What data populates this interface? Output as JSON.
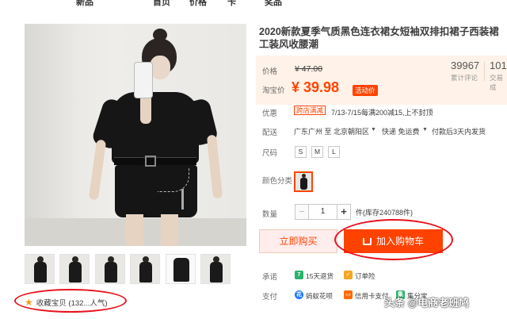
{
  "header": {
    "nav_fragments": [
      "新品",
      "首页",
      "价格",
      "卡",
      "奖品"
    ]
  },
  "product": {
    "title": "2020新款夏季气质黑色连衣裙女短袖双排扣裙子西装裙工装风收腰潮"
  },
  "price_box": {
    "price_label": "价格",
    "original_price": "¥ 47.00",
    "taobao_price_label": "淘宝价",
    "price": "¥ 39.98",
    "promo_tag": "活动价",
    "review_count": "39967",
    "review_label": "累计评论",
    "sales_count": "101",
    "sales_label": "交易成"
  },
  "promotion": {
    "label": "优惠",
    "badge": "跨店满减",
    "text": "7/13-7/15每满200减15,上不封顶"
  },
  "shipping": {
    "label": "配送",
    "origin": "广东广州 至",
    "destination": "北京朝阳区",
    "carrier": "快递 免运费",
    "note": "付款后3天内发货"
  },
  "size": {
    "label": "尺码",
    "options": [
      "S",
      "M",
      "L"
    ]
  },
  "color": {
    "label": "颜色分类"
  },
  "quantity": {
    "label": "数量",
    "minus": "−",
    "value": "1",
    "plus": "+",
    "stock": "件(库存240788件)"
  },
  "actions": {
    "buy_now": "立即购买",
    "add_to_cart": "加入购物车"
  },
  "promise": {
    "label": "承诺",
    "items": [
      "15天退货",
      "订单险"
    ]
  },
  "payment": {
    "label": "支付",
    "items": [
      "蚂蚁花呗",
      "信用卡支付",
      "集分宝"
    ]
  },
  "favorite": {
    "text": "收藏宝贝 (132...人气)"
  },
  "watermark": {
    "text": "头条 @电商老班鸠"
  },
  "colors": {
    "accent": "#ff4400",
    "price_bg": "#fff2e8",
    "highlight_ring": "#e8121d"
  }
}
